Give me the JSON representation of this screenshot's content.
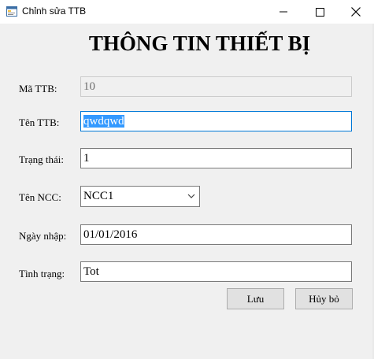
{
  "window": {
    "title": "Chỉnh sửa TTB",
    "icon": "app-form-icon"
  },
  "form": {
    "heading": "THÔNG TIN THIẾT BỊ",
    "fields": {
      "ma_ttb": {
        "label": "Mã TTB:",
        "value": "10",
        "enabled": false
      },
      "ten_ttb": {
        "label": "Tên TTB:",
        "value": "qwdqwd",
        "selected": true
      },
      "trang_thai": {
        "label": "Trạng thái:",
        "value": "1"
      },
      "ten_ncc": {
        "label": "Tên NCC:",
        "value": "NCC1"
      },
      "ngay_nhap": {
        "label": "Ngày nhập:",
        "value": "01/01/2016"
      },
      "tinh_trang": {
        "label": "Tình trạng:",
        "value": "Tot"
      }
    }
  },
  "buttons": {
    "save_label": "Lưu",
    "cancel_label": "Hủy bỏ"
  },
  "colors": {
    "selection": "#3399ff",
    "focus_border": "#0078d7",
    "background": "#f0f0f0"
  }
}
